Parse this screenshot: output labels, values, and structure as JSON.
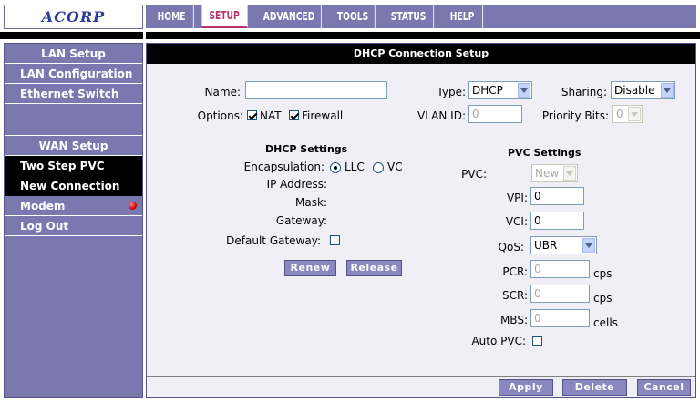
{
  "brand": {
    "logo_text": "ACORP"
  },
  "topnav": {
    "tabs": [
      {
        "label": "HOME"
      },
      {
        "label": "SETUP"
      },
      {
        "label": "ADVANCED"
      },
      {
        "label": "TOOLS"
      },
      {
        "label": "STATUS"
      },
      {
        "label": "HELP"
      }
    ],
    "active_tab": "SETUP"
  },
  "sidebar": {
    "lan_header": "LAN Setup",
    "lan_items": [
      "LAN Configuration",
      "Ethernet Switch"
    ],
    "wan_header": "WAN Setup",
    "wan_items": [
      "Two Step PVC",
      "New Connection",
      "Modem",
      "Log Out"
    ]
  },
  "panel": {
    "title": "DHCP Connection Setup",
    "name_label": "Name:",
    "name_value": "",
    "type_label": "Type:",
    "type_value": "DHCP",
    "sharing_label": "Sharing:",
    "sharing_value": "Disable",
    "options_label": "Options:",
    "nat_label": "NAT",
    "nat_checked": true,
    "firewall_label": "Firewall",
    "firewall_checked": true,
    "vlan_label": "VLAN ID:",
    "vlan_value": "0",
    "priority_label": "Priority Bits:",
    "priority_value": "0"
  },
  "dhcp": {
    "title": "DHCP Settings",
    "encap_label": "Encapsulation:",
    "encap_llc": "LLC",
    "encap_vc": "VC",
    "encap_selected": "LLC",
    "ip_label": "IP Address:",
    "mask_label": "Mask:",
    "gateway_label": "Gateway:",
    "default_gw_label": "Default Gateway:",
    "default_gw_checked": false,
    "renew_label": "Renew",
    "release_label": "Release"
  },
  "pvc": {
    "title": "PVC Settings",
    "pvc_label": "PVC:",
    "pvc_value": "New",
    "vpi_label": "VPI:",
    "vpi_value": "0",
    "vci_label": "VCI:",
    "vci_value": "0",
    "qos_label": "QoS:",
    "qos_value": "UBR",
    "pcr_label": "PCR:",
    "pcr_value": "0",
    "pcr_unit": "cps",
    "scr_label": "SCR:",
    "scr_value": "0",
    "scr_unit": "cps",
    "mbs_label": "MBS:",
    "mbs_value": "0",
    "mbs_unit": "cells",
    "auto_label": "Auto PVC:",
    "auto_checked": false
  },
  "actions": {
    "apply": "Apply",
    "delete": "Delete",
    "cancel": "Cancel"
  },
  "colors": {
    "accent": "#7b78b0",
    "active_tab": "#b8336a",
    "status_led": "#d00000"
  }
}
